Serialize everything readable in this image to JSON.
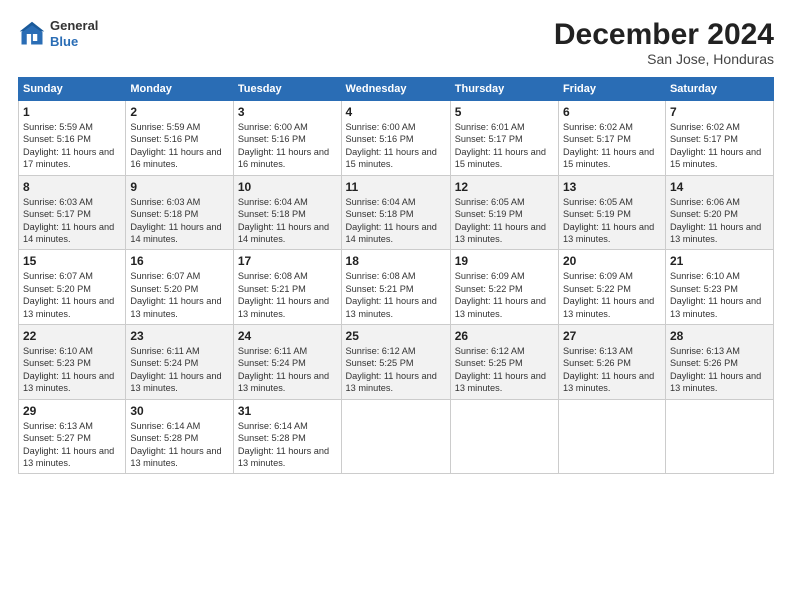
{
  "logo": {
    "general": "General",
    "blue": "Blue"
  },
  "header": {
    "month": "December 2024",
    "location": "San Jose, Honduras"
  },
  "weekdays": [
    "Sunday",
    "Monday",
    "Tuesday",
    "Wednesday",
    "Thursday",
    "Friday",
    "Saturday"
  ],
  "weeks": [
    [
      {
        "day": "1",
        "info": "Sunrise: 5:59 AM\nSunset: 5:16 PM\nDaylight: 11 hours and 17 minutes."
      },
      {
        "day": "2",
        "info": "Sunrise: 5:59 AM\nSunset: 5:16 PM\nDaylight: 11 hours and 16 minutes."
      },
      {
        "day": "3",
        "info": "Sunrise: 6:00 AM\nSunset: 5:16 PM\nDaylight: 11 hours and 16 minutes."
      },
      {
        "day": "4",
        "info": "Sunrise: 6:00 AM\nSunset: 5:16 PM\nDaylight: 11 hours and 15 minutes."
      },
      {
        "day": "5",
        "info": "Sunrise: 6:01 AM\nSunset: 5:17 PM\nDaylight: 11 hours and 15 minutes."
      },
      {
        "day": "6",
        "info": "Sunrise: 6:02 AM\nSunset: 5:17 PM\nDaylight: 11 hours and 15 minutes."
      },
      {
        "day": "7",
        "info": "Sunrise: 6:02 AM\nSunset: 5:17 PM\nDaylight: 11 hours and 15 minutes."
      }
    ],
    [
      {
        "day": "8",
        "info": "Sunrise: 6:03 AM\nSunset: 5:17 PM\nDaylight: 11 hours and 14 minutes."
      },
      {
        "day": "9",
        "info": "Sunrise: 6:03 AM\nSunset: 5:18 PM\nDaylight: 11 hours and 14 minutes."
      },
      {
        "day": "10",
        "info": "Sunrise: 6:04 AM\nSunset: 5:18 PM\nDaylight: 11 hours and 14 minutes."
      },
      {
        "day": "11",
        "info": "Sunrise: 6:04 AM\nSunset: 5:18 PM\nDaylight: 11 hours and 14 minutes."
      },
      {
        "day": "12",
        "info": "Sunrise: 6:05 AM\nSunset: 5:19 PM\nDaylight: 11 hours and 13 minutes."
      },
      {
        "day": "13",
        "info": "Sunrise: 6:05 AM\nSunset: 5:19 PM\nDaylight: 11 hours and 13 minutes."
      },
      {
        "day": "14",
        "info": "Sunrise: 6:06 AM\nSunset: 5:20 PM\nDaylight: 11 hours and 13 minutes."
      }
    ],
    [
      {
        "day": "15",
        "info": "Sunrise: 6:07 AM\nSunset: 5:20 PM\nDaylight: 11 hours and 13 minutes."
      },
      {
        "day": "16",
        "info": "Sunrise: 6:07 AM\nSunset: 5:20 PM\nDaylight: 11 hours and 13 minutes."
      },
      {
        "day": "17",
        "info": "Sunrise: 6:08 AM\nSunset: 5:21 PM\nDaylight: 11 hours and 13 minutes."
      },
      {
        "day": "18",
        "info": "Sunrise: 6:08 AM\nSunset: 5:21 PM\nDaylight: 11 hours and 13 minutes."
      },
      {
        "day": "19",
        "info": "Sunrise: 6:09 AM\nSunset: 5:22 PM\nDaylight: 11 hours and 13 minutes."
      },
      {
        "day": "20",
        "info": "Sunrise: 6:09 AM\nSunset: 5:22 PM\nDaylight: 11 hours and 13 minutes."
      },
      {
        "day": "21",
        "info": "Sunrise: 6:10 AM\nSunset: 5:23 PM\nDaylight: 11 hours and 13 minutes."
      }
    ],
    [
      {
        "day": "22",
        "info": "Sunrise: 6:10 AM\nSunset: 5:23 PM\nDaylight: 11 hours and 13 minutes."
      },
      {
        "day": "23",
        "info": "Sunrise: 6:11 AM\nSunset: 5:24 PM\nDaylight: 11 hours and 13 minutes."
      },
      {
        "day": "24",
        "info": "Sunrise: 6:11 AM\nSunset: 5:24 PM\nDaylight: 11 hours and 13 minutes."
      },
      {
        "day": "25",
        "info": "Sunrise: 6:12 AM\nSunset: 5:25 PM\nDaylight: 11 hours and 13 minutes."
      },
      {
        "day": "26",
        "info": "Sunrise: 6:12 AM\nSunset: 5:25 PM\nDaylight: 11 hours and 13 minutes."
      },
      {
        "day": "27",
        "info": "Sunrise: 6:13 AM\nSunset: 5:26 PM\nDaylight: 11 hours and 13 minutes."
      },
      {
        "day": "28",
        "info": "Sunrise: 6:13 AM\nSunset: 5:26 PM\nDaylight: 11 hours and 13 minutes."
      }
    ],
    [
      {
        "day": "29",
        "info": "Sunrise: 6:13 AM\nSunset: 5:27 PM\nDaylight: 11 hours and 13 minutes."
      },
      {
        "day": "30",
        "info": "Sunrise: 6:14 AM\nSunset: 5:28 PM\nDaylight: 11 hours and 13 minutes."
      },
      {
        "day": "31",
        "info": "Sunrise: 6:14 AM\nSunset: 5:28 PM\nDaylight: 11 hours and 13 minutes."
      },
      null,
      null,
      null,
      null
    ]
  ]
}
